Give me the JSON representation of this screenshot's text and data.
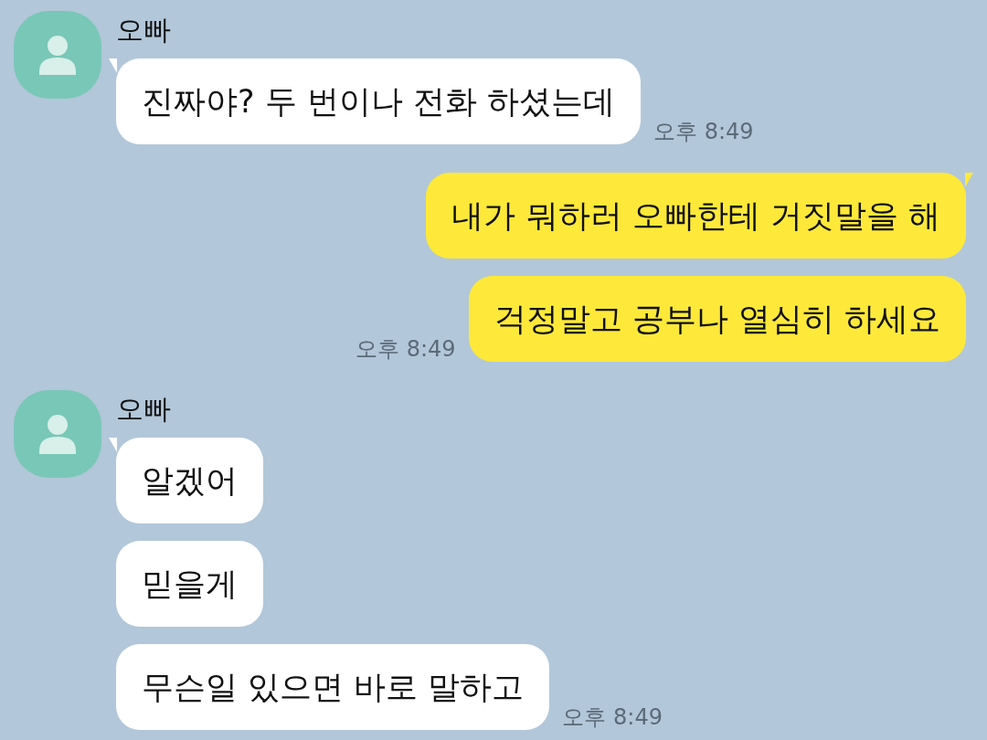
{
  "groups": [
    {
      "kind": "incoming",
      "sender": "오빠",
      "messages": [
        "진짜야? 두 번이나 전화 하셨는데"
      ],
      "time": "오후 8:49"
    },
    {
      "kind": "outgoing",
      "messages": [
        "내가 뭐하러 오빠한테 거짓말을 해",
        "걱정말고 공부나 열심히 하세요"
      ],
      "time": "오후 8:49"
    },
    {
      "kind": "incoming",
      "sender": "오빠",
      "messages": [
        "알겠어",
        "믿을게",
        "무슨일 있으면 바로 말하고"
      ],
      "time": "오후 8:49"
    }
  ]
}
